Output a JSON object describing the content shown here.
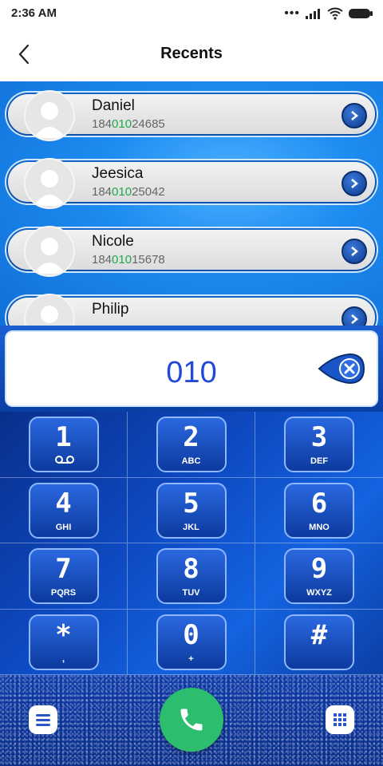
{
  "status": {
    "time": "2:36 AM"
  },
  "header": {
    "title": "Recents"
  },
  "contacts": [
    {
      "name": "Daniel",
      "num_pre": "184",
      "num_hl": "010",
      "num_post": "24685"
    },
    {
      "name": "Jeesica",
      "num_pre": "184",
      "num_hl": "010",
      "num_post": "25042"
    },
    {
      "name": "Nicole",
      "num_pre": "184",
      "num_hl": "010",
      "num_post": "15678"
    },
    {
      "name": "Philip"
    }
  ],
  "dialer": {
    "input": "010"
  },
  "keys": [
    {
      "digit": "1",
      "letters": ""
    },
    {
      "digit": "2",
      "letters": "ABC"
    },
    {
      "digit": "3",
      "letters": "DEF"
    },
    {
      "digit": "4",
      "letters": "GHI"
    },
    {
      "digit": "5",
      "letters": "JKL"
    },
    {
      "digit": "6",
      "letters": "MNO"
    },
    {
      "digit": "7",
      "letters": "PQRS"
    },
    {
      "digit": "8",
      "letters": "TUV"
    },
    {
      "digit": "9",
      "letters": "WXYZ"
    },
    {
      "digit": "*",
      "letters": ","
    },
    {
      "digit": "0",
      "letters": "+"
    },
    {
      "digit": "#",
      "letters": ""
    }
  ],
  "icons": {
    "signal": "signal-icon",
    "wifi": "wifi-icon",
    "battery": "battery-icon",
    "back": "back-arrow-icon",
    "voicemail": "voicemail-icon",
    "call": "phone-icon",
    "menu": "menu-icon",
    "dialpad": "dialpad-icon",
    "backspace": "backspace-icon"
  },
  "colors": {
    "accent": "#1d8bf0",
    "highlight": "#21a84a",
    "call": "#2dbd6e",
    "input": "#2249d8"
  }
}
